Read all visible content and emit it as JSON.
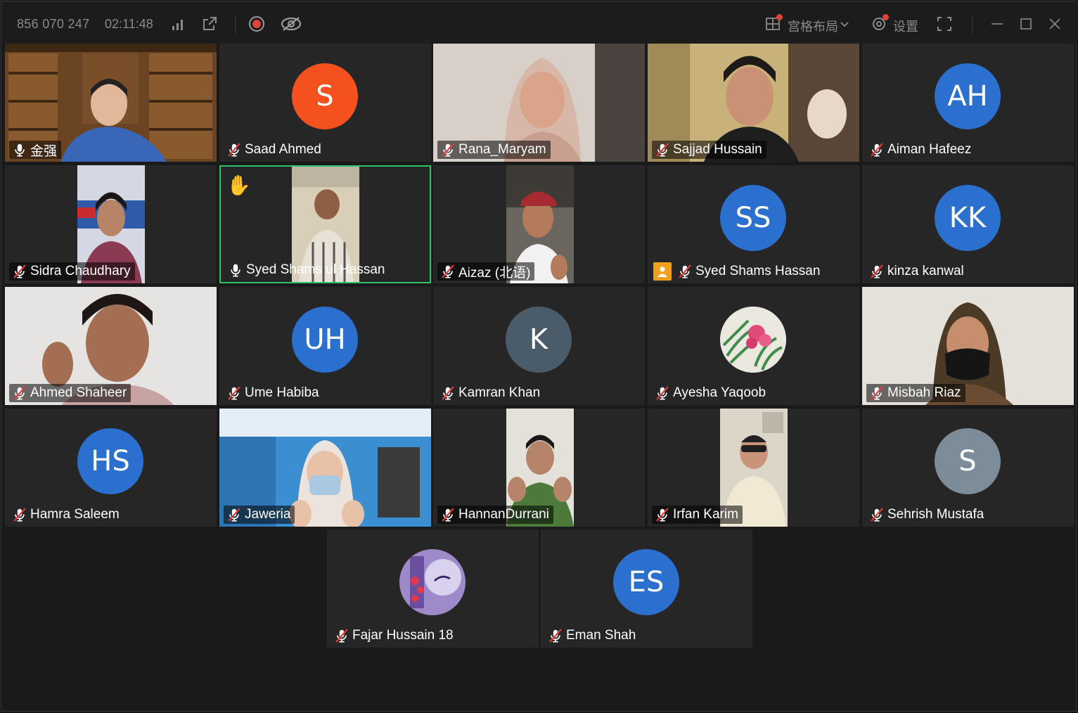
{
  "topbar": {
    "meeting_id": "856 070 247",
    "timer": "02:11:48",
    "layout_label": "宫格布局",
    "settings_label": "设置"
  },
  "colors": {
    "orange_avatar": "#f4511e",
    "blue_avatar": "#2b6fcf",
    "slate_avatar": "#4a5b69",
    "gray_avatar": "#7c8c98",
    "speaking_border": "#2ec26a",
    "host_badge": "#f0a020"
  },
  "participants": [
    {
      "name": "金强",
      "muted": false,
      "type": "video"
    },
    {
      "name": "Saad Ahmed",
      "muted": true,
      "type": "avatar",
      "initials": "S"
    },
    {
      "name": "Rana_Maryam",
      "muted": true,
      "type": "video"
    },
    {
      "name": "Sajjad Hussain",
      "muted": true,
      "type": "video"
    },
    {
      "name": "Aiman Hafeez",
      "muted": true,
      "type": "avatar",
      "initials": "AH"
    },
    {
      "name": "Sidra Chaudhary",
      "muted": true,
      "type": "video"
    },
    {
      "name": "Syed Shams ul Hassan",
      "muted": false,
      "type": "video",
      "hand_raised": true,
      "speaking": true
    },
    {
      "name": "Aizaz (北语)",
      "muted": true,
      "type": "video"
    },
    {
      "name": "Syed Shams Hassan",
      "muted": true,
      "type": "avatar",
      "initials": "SS",
      "host_badge": "person-icon"
    },
    {
      "name": "kinza kanwal",
      "muted": true,
      "type": "avatar",
      "initials": "KK"
    },
    {
      "name": "Ahmed Shaheer",
      "muted": true,
      "type": "video"
    },
    {
      "name": "Ume Habiba",
      "muted": true,
      "type": "avatar",
      "initials": "UH"
    },
    {
      "name": "Kamran Khan",
      "muted": true,
      "type": "avatar",
      "initials": "K"
    },
    {
      "name": "Ayesha Yaqoob",
      "muted": true,
      "type": "avatar-image"
    },
    {
      "name": "Misbah Riaz",
      "muted": true,
      "type": "video"
    },
    {
      "name": "Hamra Saleem",
      "muted": true,
      "type": "avatar",
      "initials": "HS"
    },
    {
      "name": "Jaweria",
      "muted": true,
      "type": "video"
    },
    {
      "name": "HannanDurrani",
      "muted": true,
      "type": "video"
    },
    {
      "name": "Irfan Karim",
      "muted": true,
      "type": "video"
    },
    {
      "name": "Sehrish Mustafa",
      "muted": true,
      "type": "avatar",
      "initials": "S"
    },
    {
      "name": "Fajar Hussain 18",
      "muted": true,
      "type": "avatar-image"
    },
    {
      "name": "Eman Shah",
      "muted": true,
      "type": "avatar",
      "initials": "ES"
    }
  ]
}
